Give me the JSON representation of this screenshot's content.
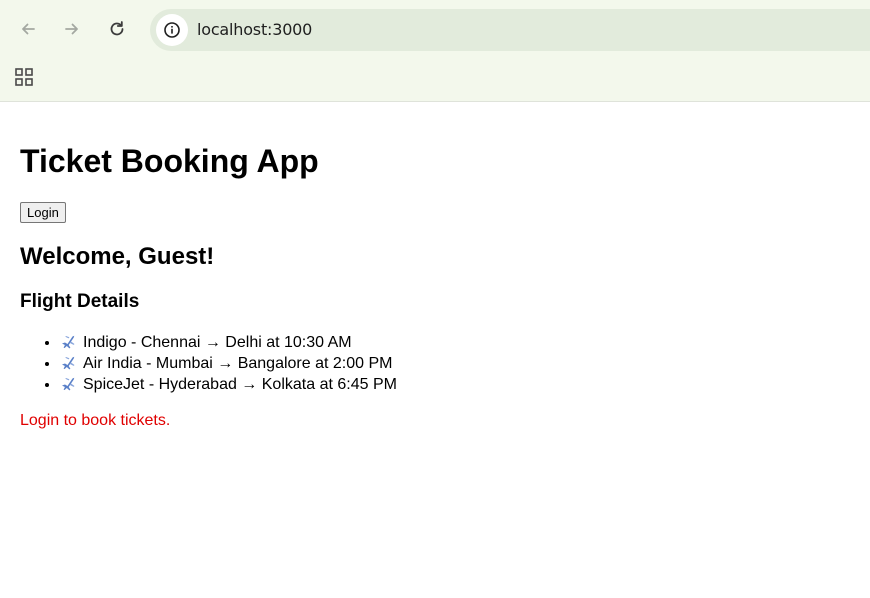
{
  "browser": {
    "url": "localhost:3000",
    "icons": [
      "back-icon",
      "forward-icon",
      "reload-icon",
      "info-icon",
      "apps-icon"
    ]
  },
  "app": {
    "title": "Ticket Booking App",
    "login_button": "Login",
    "welcome": "Welcome, Guest!",
    "flights_heading": "Flight Details",
    "flights": [
      {
        "airline": "Indigo",
        "text": "Indigo - Chennai → Delhi at 10:30 AM"
      },
      {
        "airline": "Air India",
        "text": "Air India - Mumbai → Bangalore at 2:00 PM"
      },
      {
        "airline": "SpiceJet",
        "text": "SpiceJet - Hyderabad → Kolkata at 6:45 PM"
      }
    ],
    "login_message": "Login to book tickets.",
    "colors": {
      "message": "#e00000",
      "chrome_bg": "#f3f8ec",
      "omnibox_bg": "#e2ebdc"
    }
  }
}
